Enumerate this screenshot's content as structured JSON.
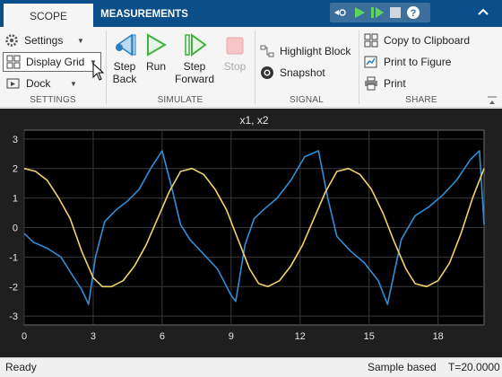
{
  "tabs": [
    {
      "label": "SCOPE",
      "active": true
    },
    {
      "label": "MEASUREMENTS",
      "active": false
    }
  ],
  "quick_access": [
    "model-highlight-icon",
    "run-icon",
    "step-forward-icon",
    "stop-icon",
    "help-icon",
    "collapse-icon"
  ],
  "ribbon": {
    "settings": {
      "label": "SETTINGS",
      "items": [
        {
          "label": "Settings",
          "icon": "gear-icon"
        },
        {
          "label": "Display Grid",
          "icon": "grid-layout-icon"
        },
        {
          "label": "Dock",
          "icon": "dock-icon"
        }
      ]
    },
    "simulate": {
      "label": "SIMULATE",
      "step_back": "Step Back",
      "step_back_l1": "Step",
      "step_back_l2": "Back",
      "run": "Run",
      "step_forward_l1": "Step",
      "step_forward_l2": "Forward",
      "stop": "Stop"
    },
    "signal": {
      "label": "SIGNAL",
      "highlight": "Highlight Block",
      "snapshot": "Snapshot"
    },
    "share": {
      "label": "SHARE",
      "copy": "Copy to Clipboard",
      "print_figure": "Print to Figure",
      "print": "Print"
    }
  },
  "colors": {
    "tab_bar": "#0b4f8a",
    "plot_bg": "#1f1f1f",
    "axes_bg": "#000000",
    "series_x1": "#2f8fd6",
    "series_x2": "#f2d36b",
    "run_green": "#3fb13f"
  },
  "chart_data": {
    "type": "line",
    "title": "x1, x2",
    "xlim": [
      0,
      20
    ],
    "ylim": [
      -3.3,
      3.3
    ],
    "xticks": [
      0,
      3,
      6,
      9,
      12,
      15,
      18
    ],
    "yticks": [
      -3,
      -2,
      -1,
      0,
      1,
      2,
      3
    ],
    "grid": true,
    "series": [
      {
        "name": "x1",
        "color": "#2f8fd6",
        "x": [
          0,
          0.4,
          1.0,
          1.6,
          2.0,
          2.5,
          2.8,
          3.1,
          3.5,
          4.0,
          4.5,
          5.0,
          5.5,
          6.0,
          6.4,
          6.8,
          7.2,
          7.8,
          8.4,
          9.0,
          9.2,
          9.6,
          10.0,
          10.4,
          11.0,
          11.6,
          12.2,
          12.8,
          13.2,
          13.6,
          14.2,
          14.8,
          15.4,
          15.8,
          16.4,
          17.0,
          17.6,
          18.2,
          18.8,
          19.4,
          19.8,
          20.0
        ],
        "y": [
          -0.2,
          -0.5,
          -0.7,
          -1.0,
          -1.5,
          -2.1,
          -2.6,
          -1.0,
          0.2,
          0.6,
          0.9,
          1.3,
          2.0,
          2.6,
          1.4,
          0.1,
          -0.4,
          -0.9,
          -1.4,
          -2.3,
          -2.5,
          -0.6,
          0.3,
          0.6,
          1.0,
          1.6,
          2.4,
          2.6,
          1.0,
          -0.3,
          -0.8,
          -1.2,
          -1.8,
          -2.6,
          -0.4,
          0.4,
          0.7,
          1.1,
          1.6,
          2.3,
          2.6,
          0.1
        ]
      },
      {
        "name": "x2",
        "color": "#f2d36b",
        "x": [
          0,
          0.5,
          1.0,
          1.5,
          2.0,
          2.5,
          3.0,
          3.4,
          3.8,
          4.3,
          4.8,
          5.3,
          5.8,
          6.3,
          6.8,
          7.3,
          7.8,
          8.3,
          8.8,
          9.3,
          9.8,
          10.2,
          10.6,
          11.1,
          11.6,
          12.1,
          12.6,
          13.1,
          13.6,
          14.1,
          14.6,
          15.1,
          15.6,
          16.1,
          16.6,
          17.0,
          17.5,
          18.0,
          18.5,
          19.0,
          19.5,
          20.0
        ],
        "y": [
          2.0,
          1.9,
          1.6,
          1.0,
          0.3,
          -0.8,
          -1.7,
          -2.0,
          -2.0,
          -1.8,
          -1.3,
          -0.6,
          0.3,
          1.2,
          1.9,
          2.0,
          1.8,
          1.3,
          0.6,
          -0.4,
          -1.4,
          -1.9,
          -2.0,
          -1.8,
          -1.3,
          -0.6,
          0.3,
          1.2,
          1.9,
          2.0,
          1.8,
          1.3,
          0.5,
          -0.5,
          -1.4,
          -1.9,
          -2.0,
          -1.8,
          -1.2,
          -0.2,
          1.0,
          2.0
        ]
      }
    ]
  },
  "status": {
    "state": "Ready",
    "mode": "Sample based",
    "time": "T=20.0000"
  }
}
